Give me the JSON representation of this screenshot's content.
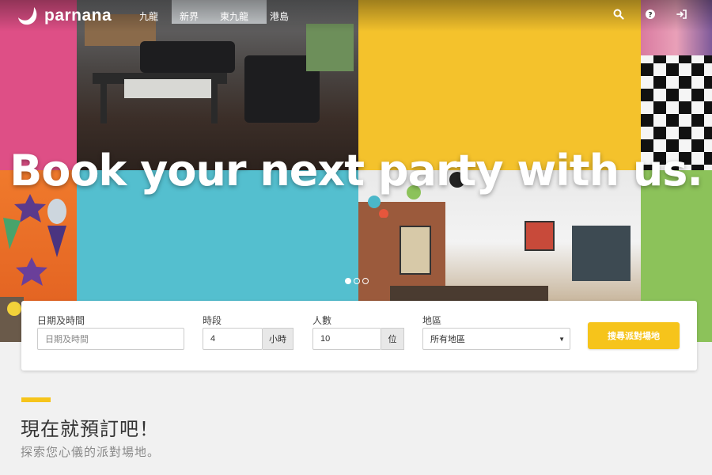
{
  "brand": {
    "name": "parnana"
  },
  "nav": {
    "links": [
      "九龍",
      "新界",
      "東九龍",
      "港島"
    ],
    "icons": [
      "search-icon",
      "help-icon",
      "login-icon"
    ]
  },
  "hero": {
    "title": "Book your next party with us.",
    "carousel": {
      "total": 3,
      "active": 1
    }
  },
  "search": {
    "datetime": {
      "label": "日期及時間",
      "placeholder": "日期及時間"
    },
    "duration": {
      "label": "時段",
      "value": "4",
      "unit": "小時"
    },
    "people": {
      "label": "人數",
      "value": "10",
      "unit": "位"
    },
    "region": {
      "label": "地區",
      "value": "所有地區"
    },
    "submit_label": "搜尋派對場地"
  },
  "section": {
    "title": "現在就預訂吧！",
    "subtitle": "探索您心儀的派對場地。"
  },
  "colors": {
    "pink": "#de4f86",
    "orange": "#ee6a2a",
    "teal": "#54bfcf",
    "yellow": "#f4c22c",
    "green": "#8cc25a",
    "accent": "#f6c41b"
  }
}
